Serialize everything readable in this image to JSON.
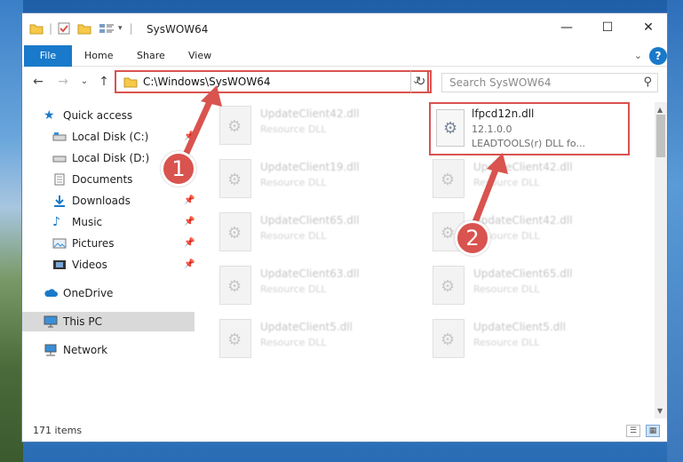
{
  "window": {
    "title": "SysWOW64",
    "controls": {
      "minimize": "—",
      "maximize": "☐",
      "close": "✕"
    }
  },
  "ribbon": {
    "tabs": [
      {
        "label": "File"
      },
      {
        "label": "Home"
      },
      {
        "label": "Share"
      },
      {
        "label": "View"
      }
    ]
  },
  "nav": {
    "address": "C:\\Windows\\SysWOW64",
    "search_placeholder": "Search SysWOW64"
  },
  "sidebar": {
    "items": [
      {
        "label": "Quick access"
      },
      {
        "label": "Local Disk (C:)"
      },
      {
        "label": "Local Disk (D:)"
      },
      {
        "label": "Documents"
      },
      {
        "label": "Downloads"
      },
      {
        "label": "Music"
      },
      {
        "label": "Pictures"
      },
      {
        "label": "Videos"
      },
      {
        "label": "OneDrive"
      },
      {
        "label": "This PC"
      },
      {
        "label": "Network"
      }
    ]
  },
  "files": {
    "left": [
      {
        "name": "UpdateClient42.dll",
        "desc": "Resource DLL"
      },
      {
        "name": "UpdateClient19.dll",
        "desc": "Resource DLL"
      },
      {
        "name": "UpdateClient65.dll",
        "desc": "Resource DLL"
      },
      {
        "name": "UpdateClient63.dll",
        "desc": "Resource DLL"
      },
      {
        "name": "UpdateClient5.dll",
        "desc": "Resource DLL"
      }
    ],
    "right": [
      {
        "name": "UpdateClient42.dll",
        "desc": "Resource DLL"
      },
      {
        "name": "UpdateClient42.dll",
        "desc": "Resource DLL"
      },
      {
        "name": "UpdateClient65.dll",
        "desc": "Resource DLL"
      },
      {
        "name": "UpdateClient5.dll",
        "desc": "Resource DLL"
      }
    ],
    "highlighted": {
      "name": "lfpcd12n.dll",
      "version": "12.1.0.0",
      "desc": "LEADTOOLS(r) DLL fo..."
    }
  },
  "status": {
    "count": "171 items"
  },
  "annotations": {
    "badge1": "1",
    "badge2": "2",
    "color": "#d9534f"
  }
}
